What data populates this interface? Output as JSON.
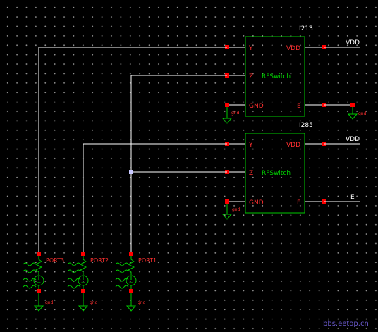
{
  "schematic": {
    "instances": [
      {
        "name": "I213",
        "cell": "RFSwitch",
        "pins": {
          "y": "Y",
          "z": "Z",
          "gnd": "GND",
          "vdd": "VDD",
          "e": "E"
        },
        "nets": {
          "vdd": "VDD",
          "gnd": "gnd"
        }
      },
      {
        "name": "I285",
        "cell": "RFSwitch",
        "pins": {
          "y": "Y",
          "z": "Z",
          "gnd": "GND",
          "vdd": "VDD",
          "e": "E"
        },
        "nets": {
          "vdd": "VDD",
          "e": "E",
          "gnd": "gnd"
        }
      }
    ],
    "ports": [
      {
        "name": "PORT3",
        "gnd": "gnd"
      },
      {
        "name": "PORT2",
        "gnd": "gnd"
      },
      {
        "name": "PORT1",
        "gnd": "gnd"
      }
    ],
    "watermark": "bbs.eetop.cn"
  },
  "colors": {
    "background": "#000000",
    "wire": "#ffffff",
    "instance_outline": "#00c800",
    "pin_label": "#ff3030",
    "cell_label": "#00d000",
    "net_label": "#ffffff",
    "pin_marker": "#ff0000",
    "grid_dot": "#8f8f8f"
  }
}
